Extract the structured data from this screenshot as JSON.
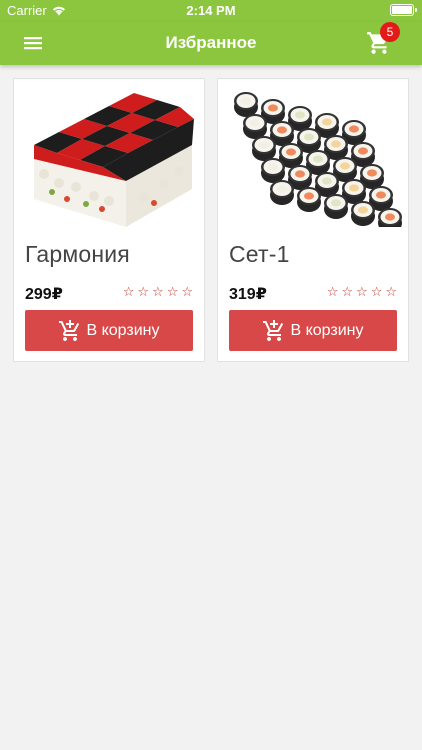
{
  "status": {
    "carrier": "Carrier",
    "time": "2:14 PM"
  },
  "nav": {
    "title": "Избранное",
    "cart_count": "5"
  },
  "products": [
    {
      "name": "Гармония",
      "price": "299₽",
      "rating": 0,
      "rating_max": 5,
      "button_label": "В корзину"
    },
    {
      "name": "Сет-1",
      "price": "319₽",
      "rating": 0,
      "rating_max": 5,
      "button_label": "В корзину"
    }
  ],
  "colors": {
    "accent": "#8cc63f",
    "button": "#d84848",
    "badge": "#e21a1a",
    "star": "#c0392b"
  },
  "icons": [
    "menu-icon",
    "cart-icon",
    "add-to-cart-icon",
    "wifi-icon",
    "battery-icon",
    "star-outline-icon"
  ]
}
